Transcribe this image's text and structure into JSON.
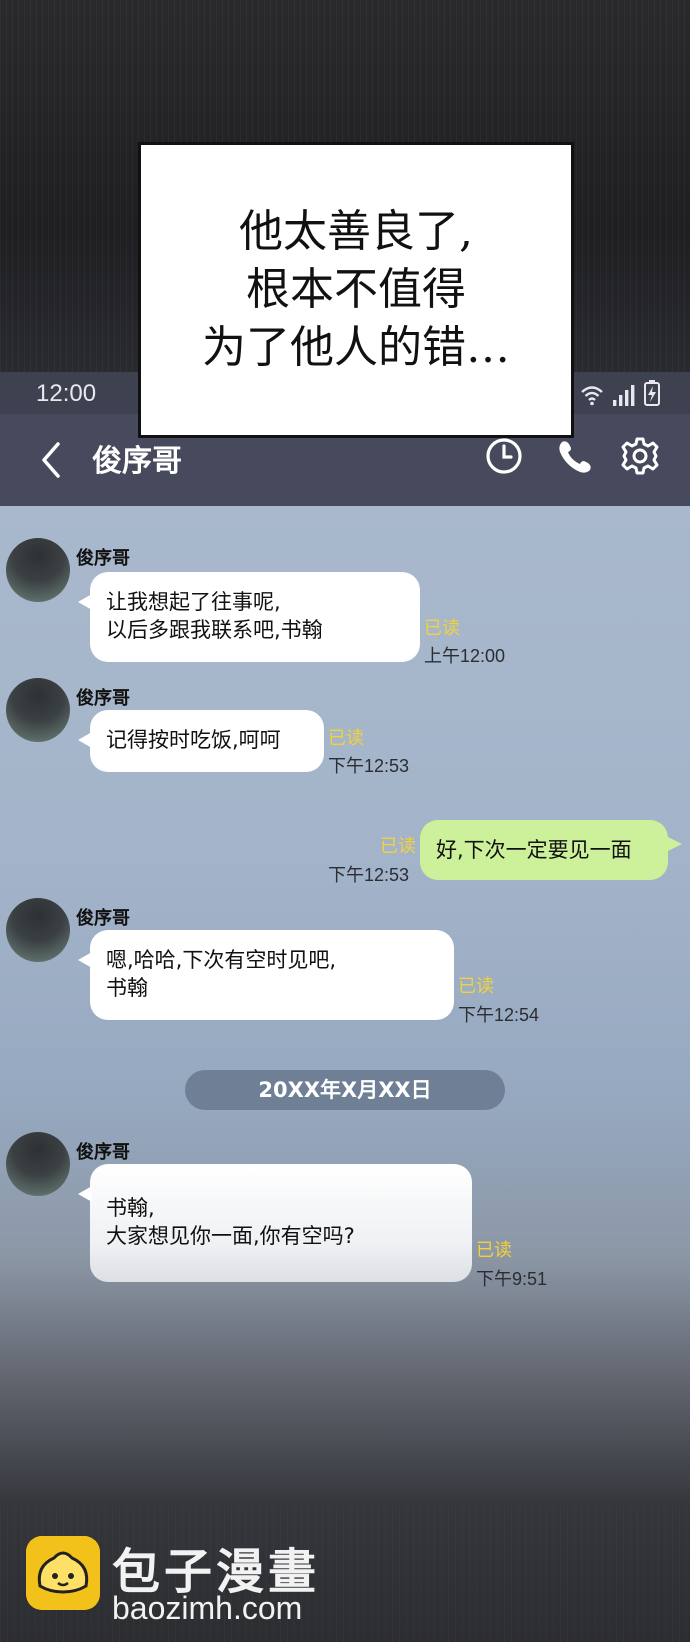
{
  "caption": {
    "lines": [
      "他太善良了,",
      "根本不值得",
      "为了他人的错…"
    ]
  },
  "status_bar": {
    "time": "12:00",
    "icons": [
      "wifi-icon",
      "signal-icon",
      "battery-icon"
    ]
  },
  "header": {
    "back_icon": "chevron-left-icon",
    "title": "俊序哥",
    "actions": [
      "clock-icon",
      "phone-icon",
      "gear-icon"
    ]
  },
  "messages": [
    {
      "sender": "俊序哥",
      "lines": [
        "让我想起了往事呢,",
        "以后多跟我联系吧,书翰"
      ],
      "read": "已读",
      "time": "上午12:00"
    },
    {
      "sender": "俊序哥",
      "lines": [
        "记得按时吃饭,呵呵"
      ],
      "read": "已读",
      "time": "下午12:53"
    },
    {
      "sender": "me",
      "lines": [
        "好,下次一定要见一面"
      ],
      "read": "已读",
      "time": "下午12:53"
    },
    {
      "sender": "俊序哥",
      "lines": [
        "嗯,哈哈,下次有空时见吧,",
        "书翰"
      ],
      "read": "已读",
      "time": "下午12:54"
    },
    {
      "sender": "俊序哥",
      "lines": [
        "书翰,",
        "大家想见你一面,你有空吗?"
      ],
      "read": "已读",
      "time": "下午9:51"
    }
  ],
  "date_divider": "20XX年X月XX日",
  "watermark": {
    "title": "包子漫畫",
    "url": "baozimh.com"
  },
  "colors": {
    "header_bg": "#474a5c",
    "status_bg": "#3e4150",
    "my_bubble": "#cdf19a",
    "read_label": "#f2d23a",
    "date_pill": "#6f7f95",
    "logo_yellow": "#f3c21a"
  }
}
